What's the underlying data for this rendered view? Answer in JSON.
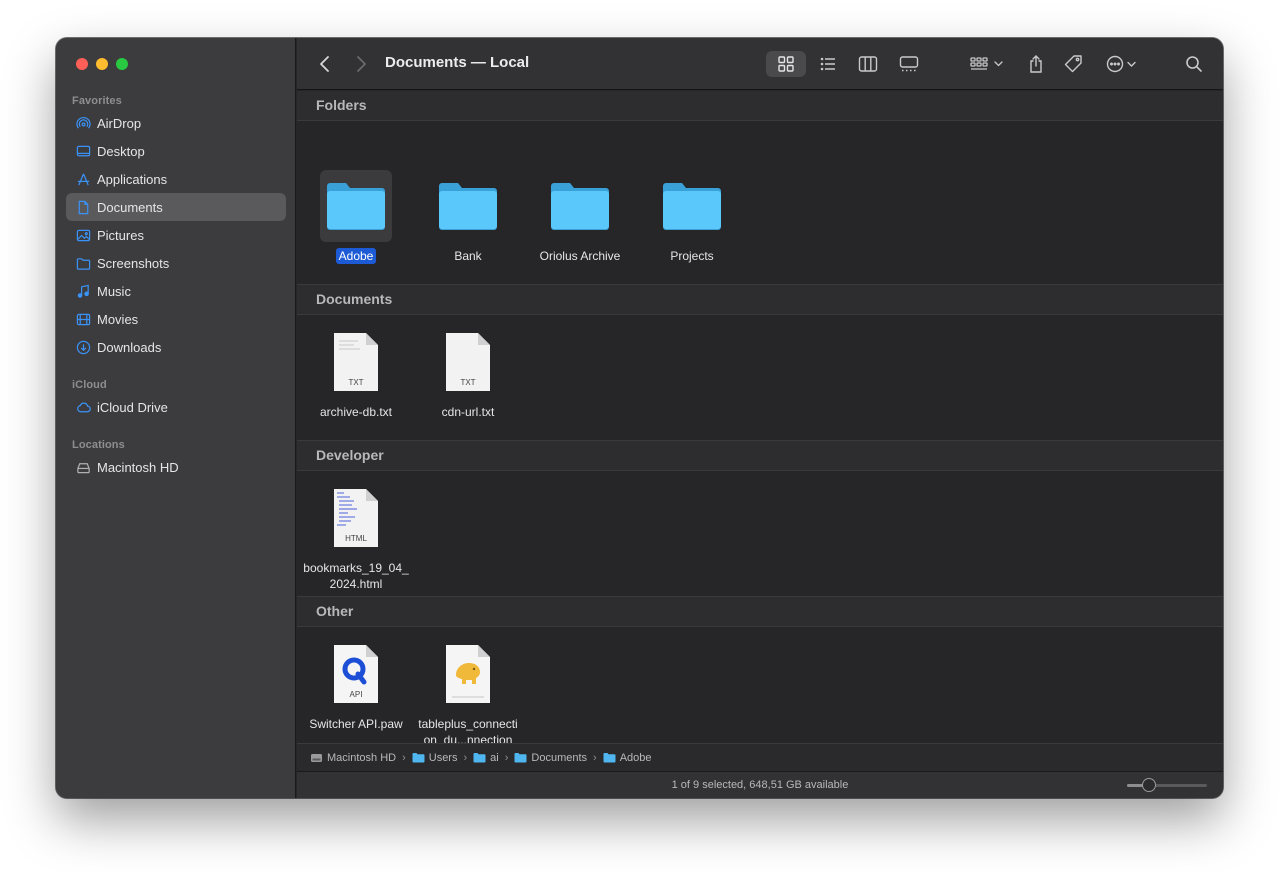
{
  "window": {
    "title": "Documents — Local"
  },
  "sidebar": {
    "favorites_label": "Favorites",
    "icloud_label": "iCloud",
    "locations_label": "Locations",
    "favorites": [
      {
        "label": "AirDrop",
        "icon": "airdrop-icon"
      },
      {
        "label": "Desktop",
        "icon": "desktop-icon"
      },
      {
        "label": "Applications",
        "icon": "applications-icon"
      },
      {
        "label": "Documents",
        "icon": "document-icon",
        "selected": true
      },
      {
        "label": "Pictures",
        "icon": "pictures-icon"
      },
      {
        "label": "Screenshots",
        "icon": "folder-icon"
      },
      {
        "label": "Music",
        "icon": "music-icon"
      },
      {
        "label": "Movies",
        "icon": "movies-icon"
      },
      {
        "label": "Downloads",
        "icon": "downloads-icon"
      }
    ],
    "icloud": [
      {
        "label": "iCloud Drive",
        "icon": "cloud-icon"
      }
    ],
    "locations": [
      {
        "label": "Macintosh HD",
        "icon": "disk-icon"
      }
    ]
  },
  "groups": {
    "folders": {
      "title": "Folders",
      "items": [
        {
          "label": "Adobe",
          "selected": true
        },
        {
          "label": "Bank"
        },
        {
          "label": "Oriolus Archive"
        },
        {
          "label": "Projects"
        }
      ]
    },
    "documents": {
      "title": "Documents",
      "items": [
        {
          "label": "archive-db.txt",
          "badge": "TXT"
        },
        {
          "label": "cdn-url.txt",
          "badge": "TXT"
        }
      ]
    },
    "developer": {
      "title": "Developer",
      "items": [
        {
          "label": "bookmarks_19_04_2024.html",
          "badge": "HTML"
        }
      ]
    },
    "other": {
      "title": "Other",
      "items": [
        {
          "label": "Switcher API.paw",
          "badge": "API"
        },
        {
          "label": "tableplus_connection_du...nnection"
        }
      ]
    }
  },
  "pathbar": {
    "crumbs": [
      "Macintosh HD",
      "Users",
      "ai",
      "Documents",
      "Adobe"
    ]
  },
  "status": {
    "text": "1 of 9 selected, 648,51 GB available",
    "zoom_level": 0.28
  },
  "colors": {
    "accent": "#1d5bd6",
    "folder": "#5ac8fa",
    "sidebar_icon": "#3a93f7"
  }
}
